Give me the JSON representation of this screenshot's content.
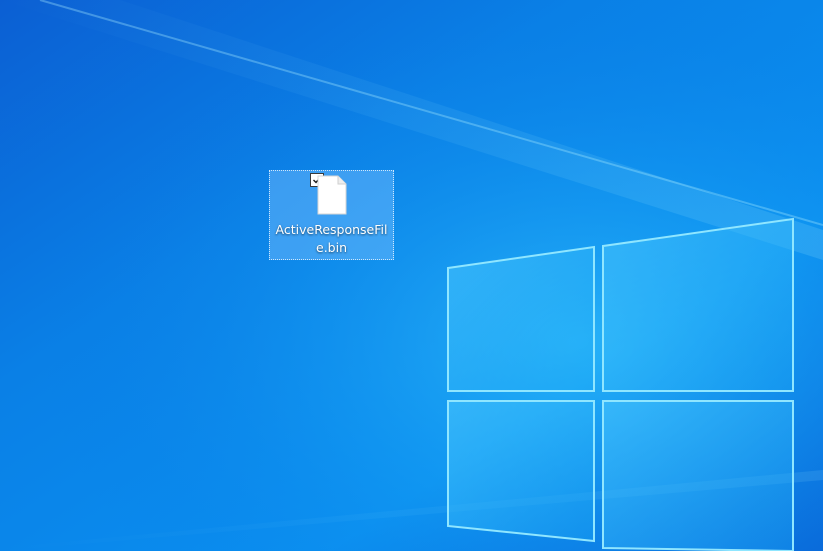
{
  "desktop": {
    "icons": [
      {
        "label": "ActiveResponseFile.bin",
        "icon": "blank-file-icon",
        "selected": true,
        "checkbox_checked": true
      }
    ]
  },
  "colors": {
    "wallpaper_base": "#0879e0",
    "wallpaper_light": "#25c1ff",
    "selection_fill": "#78beff",
    "label_text": "#ffffff"
  }
}
